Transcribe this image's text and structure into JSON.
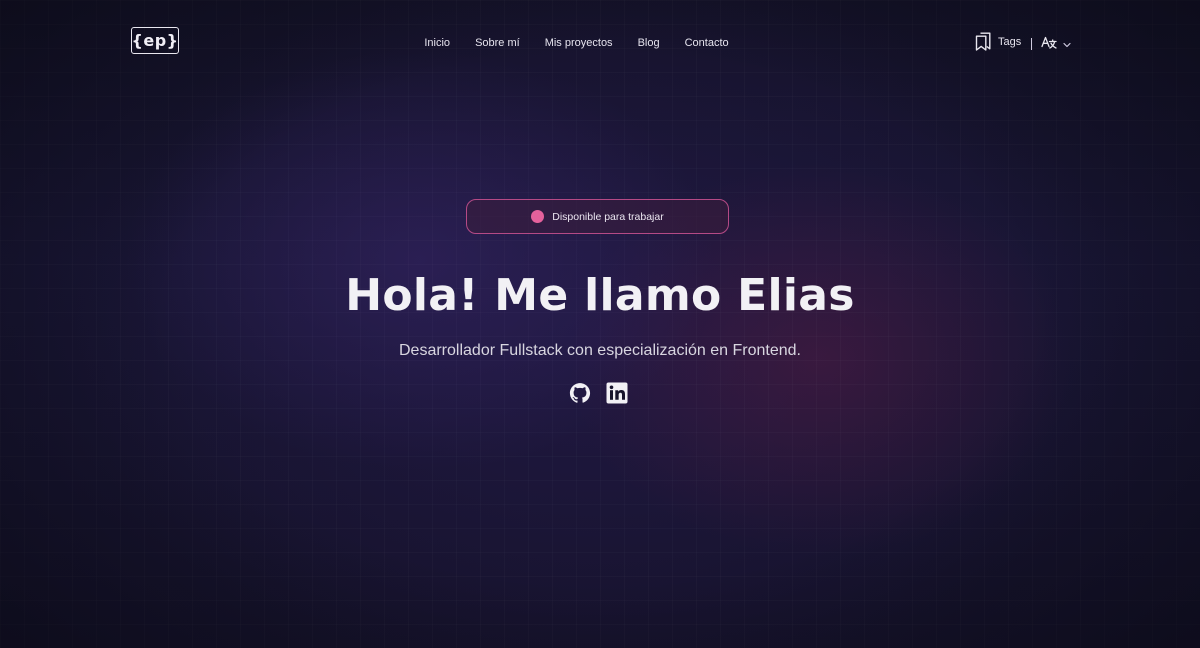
{
  "header": {
    "logo_text": "{ep}",
    "nav": [
      {
        "label": "Inicio"
      },
      {
        "label": "Sobre mí"
      },
      {
        "label": "Mis proyectos"
      },
      {
        "label": "Blog"
      },
      {
        "label": "Contacto"
      }
    ],
    "tags_label": "Tags",
    "tags_icon": "bookmarks-icon",
    "language_icon": "translate-icon",
    "language_chevron_icon": "chevron-down-icon"
  },
  "hero": {
    "badge_text": "Disponible para trabajar",
    "badge_dot_color": "#e5619c",
    "title": "Hola! Me llamo Elias",
    "subtitle": "Desarrollador Fullstack con especialización en Frontend.",
    "socials": [
      {
        "icon": "github-icon"
      },
      {
        "icon": "linkedin-icon"
      }
    ]
  },
  "theme": {
    "background": "#14132a",
    "accent": "#e5619c",
    "text": "#f2f1f5"
  }
}
